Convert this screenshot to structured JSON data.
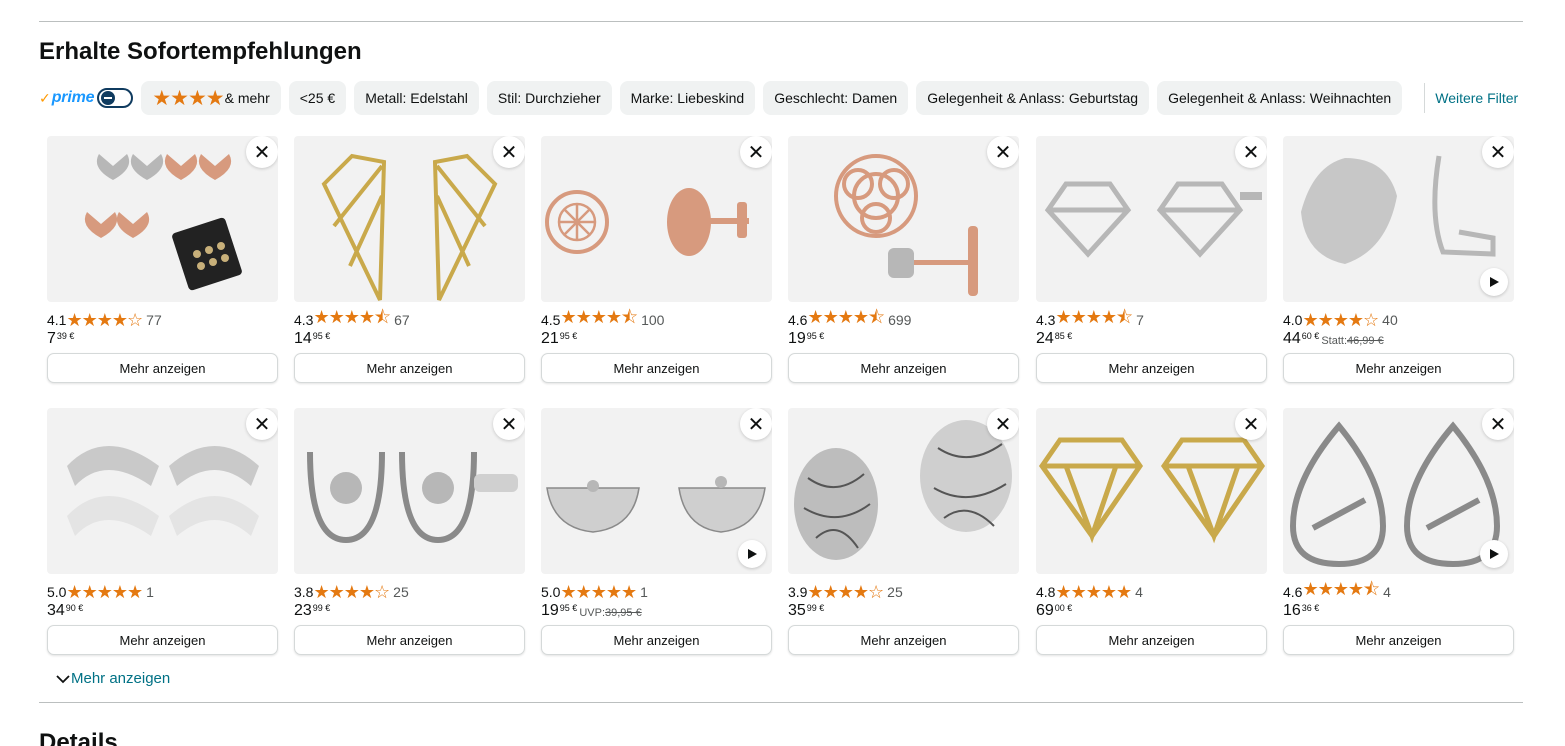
{
  "section_title": "Erhalte Sofortempfehlungen",
  "filters": {
    "prime_check": "✓",
    "prime_label": "prime",
    "rating_chip_stars": "★★★★",
    "rating_chip_text": "& mehr",
    "chips": [
      "<25 €",
      "Metall: Edelstahl",
      "Stil: Durchzieher",
      "Marke: Liebeskind",
      "Geschlecht: Damen",
      "Gelegenheit & Anlass: Geburtstag",
      "Gelegenheit & Anlass: Weihnachten"
    ],
    "more_filters": "Weitere Filter"
  },
  "products": [
    {
      "rating": "4.1",
      "stars": "★★★★☆",
      "count": "77",
      "price_whole": "7",
      "price_frac": "39 €",
      "was_prefix": "",
      "was": "",
      "has_video": false,
      "button": "Mehr anzeigen"
    },
    {
      "rating": "4.3",
      "stars": "★★★★⯪",
      "count": "67",
      "price_whole": "14",
      "price_frac": "95 €",
      "was_prefix": "",
      "was": "",
      "has_video": false,
      "button": "Mehr anzeigen"
    },
    {
      "rating": "4.5",
      "stars": "★★★★⯪",
      "count": "100",
      "price_whole": "21",
      "price_frac": "95 €",
      "was_prefix": "",
      "was": "",
      "has_video": false,
      "button": "Mehr anzeigen"
    },
    {
      "rating": "4.6",
      "stars": "★★★★⯪",
      "count": "699",
      "price_whole": "19",
      "price_frac": "95 €",
      "was_prefix": "",
      "was": "",
      "has_video": false,
      "button": "Mehr anzeigen"
    },
    {
      "rating": "4.3",
      "stars": "★★★★⯪",
      "count": "7",
      "price_whole": "24",
      "price_frac": "85 €",
      "was_prefix": "",
      "was": "",
      "has_video": false,
      "button": "Mehr anzeigen"
    },
    {
      "rating": "4.0",
      "stars": "★★★★☆",
      "count": "40",
      "price_whole": "44",
      "price_frac": "60 €",
      "was_prefix": "Statt:",
      "was": "46,99 €",
      "has_video": true,
      "button": "Mehr anzeigen"
    },
    {
      "rating": "5.0",
      "stars": "★★★★★",
      "count": "1",
      "price_whole": "34",
      "price_frac": "90 €",
      "was_prefix": "",
      "was": "",
      "has_video": false,
      "button": "Mehr anzeigen"
    },
    {
      "rating": "3.8",
      "stars": "★★★★☆",
      "count": "25",
      "price_whole": "23",
      "price_frac": "99 €",
      "was_prefix": "",
      "was": "",
      "has_video": false,
      "button": "Mehr anzeigen"
    },
    {
      "rating": "5.0",
      "stars": "★★★★★",
      "count": "1",
      "price_whole": "19",
      "price_frac": "95 €",
      "was_prefix": "UVP:",
      "was": "39,95 €",
      "has_video": true,
      "button": "Mehr anzeigen"
    },
    {
      "rating": "3.9",
      "stars": "★★★★☆",
      "count": "25",
      "price_whole": "35",
      "price_frac": "99 €",
      "was_prefix": "",
      "was": "",
      "has_video": false,
      "button": "Mehr anzeigen"
    },
    {
      "rating": "4.8",
      "stars": "★★★★★",
      "count": "4",
      "price_whole": "69",
      "price_frac": "00 €",
      "was_prefix": "",
      "was": "",
      "has_video": false,
      "button": "Mehr anzeigen"
    },
    {
      "rating": "4.6",
      "stars": "★★★★⯪",
      "count": "4",
      "price_whole": "16",
      "price_frac": "36 €",
      "was_prefix": "",
      "was": "",
      "has_video": true,
      "button": "Mehr anzeigen"
    }
  ],
  "icons": {
    "close": "close-icon",
    "play": "play-icon",
    "chevron": "chevron-down-icon"
  },
  "colors": {
    "star": "#e47911",
    "link": "#007185",
    "prime": "#1a98ff",
    "chip_bg": "#f0f2f2"
  },
  "expand_label": "Mehr anzeigen",
  "details_title": "Details"
}
